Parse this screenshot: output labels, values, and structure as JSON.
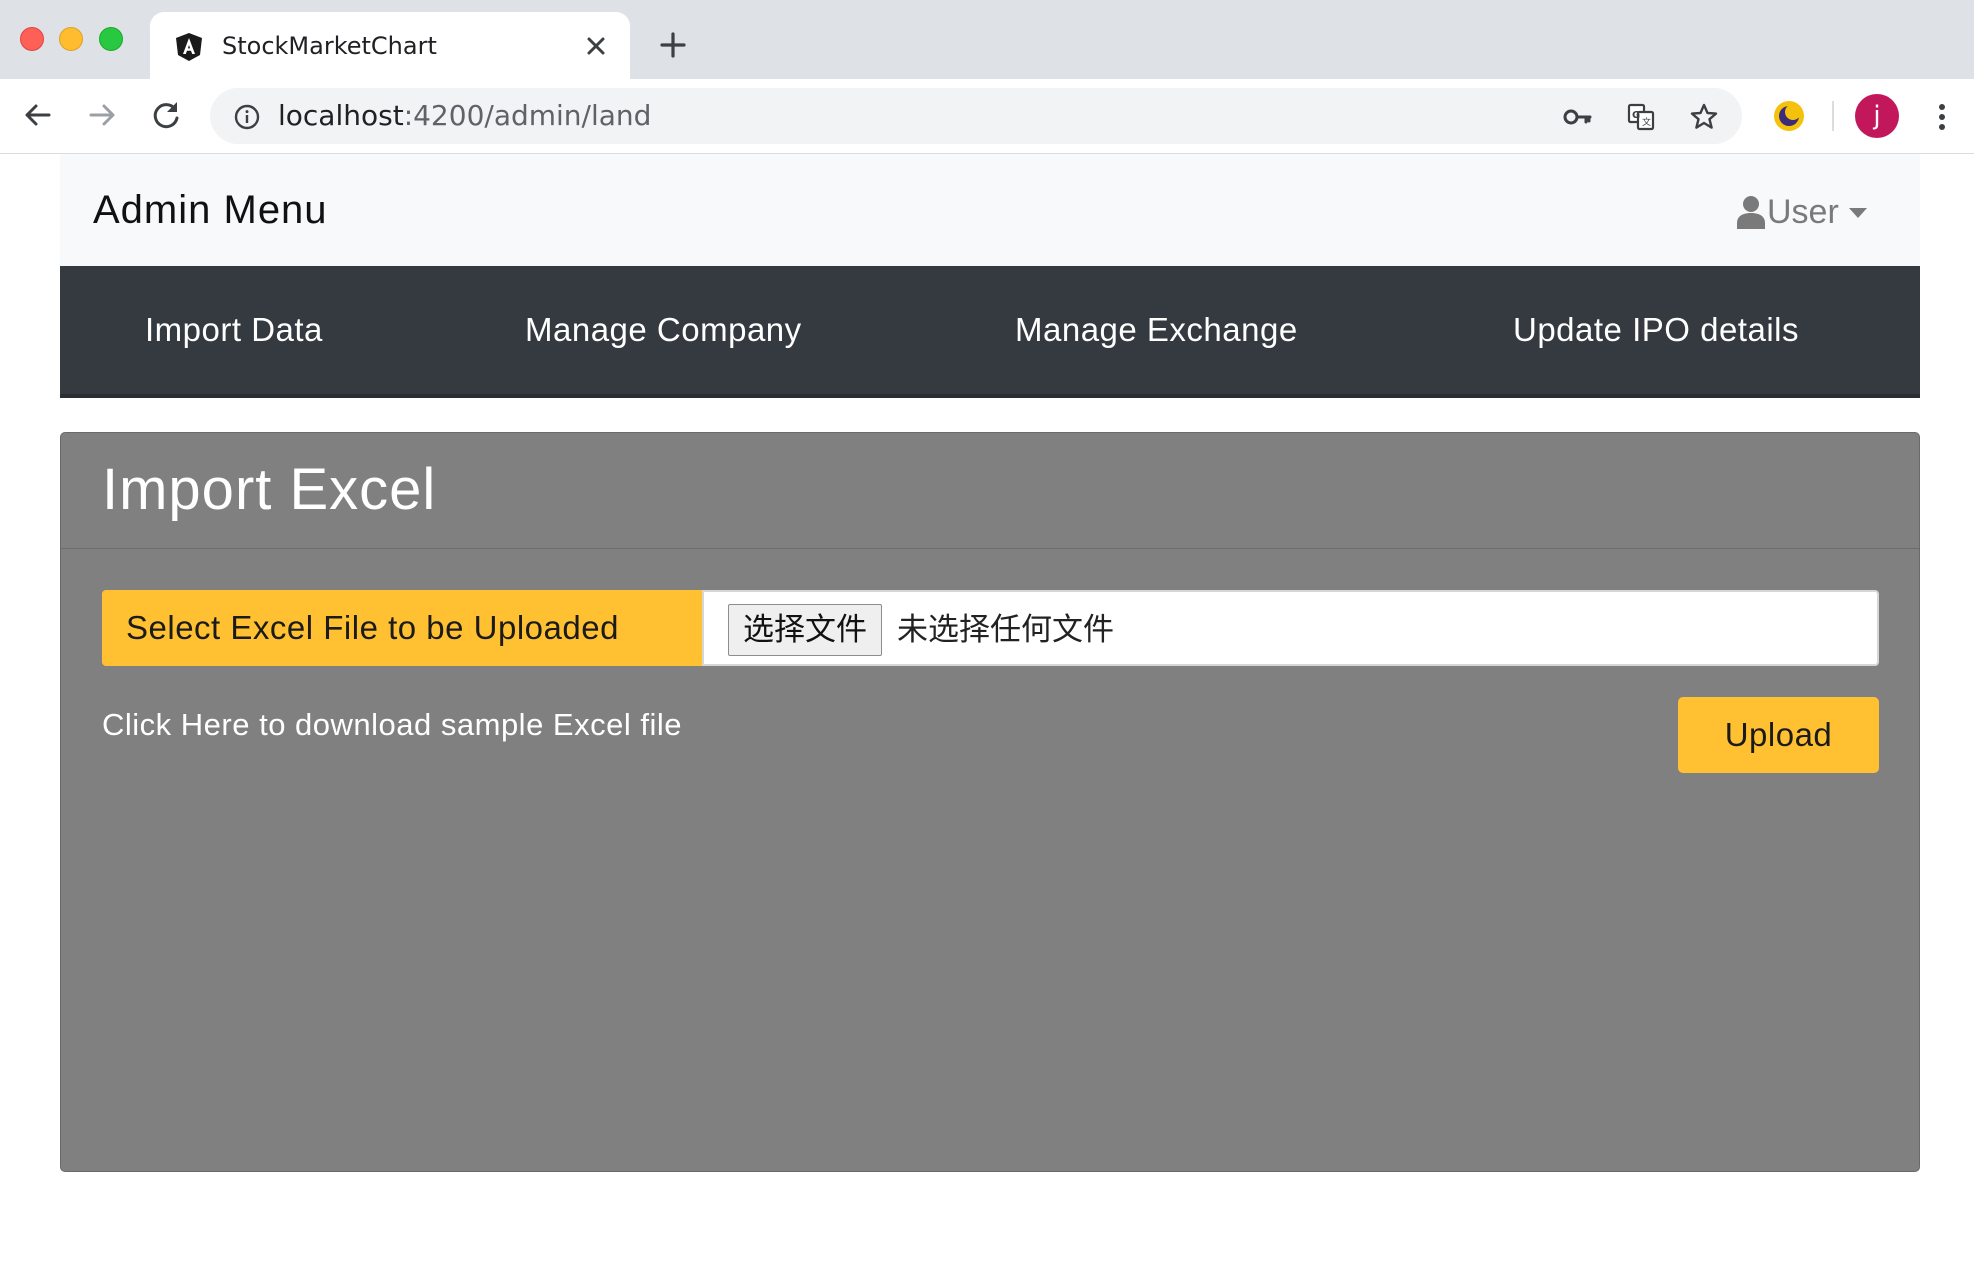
{
  "browser": {
    "tab_title": "StockMarketChart",
    "url_host": "localhost",
    "url_path": ":4200/admin/land",
    "avatar_letter": "j",
    "icons": [
      "angular-favicon",
      "close-icon",
      "plus-icon",
      "back-arrow-icon",
      "forward-arrow-icon",
      "reload-icon",
      "info-icon",
      "key-icon",
      "translate-icon",
      "star-icon",
      "extension-moon-icon",
      "kebab-menu-icon"
    ]
  },
  "header": {
    "brand": "Admin Menu",
    "user_label": "User"
  },
  "nav": {
    "items": [
      {
        "label": "Import Data"
      },
      {
        "label": "Manage Company"
      },
      {
        "label": "Manage Exchange"
      },
      {
        "label": "Update IPO details"
      }
    ]
  },
  "card": {
    "title": "Import Excel",
    "file_label": "Select Excel File to be Uploaded",
    "choose_button": "选择文件",
    "file_status": "未选择任何文件",
    "sample_link": "Click Here to download sample Excel file",
    "upload_button": "Upload"
  },
  "colors": {
    "navbar_bg": "#343a40",
    "card_bg": "#808080",
    "accent_yellow": "#ffc132",
    "admin_bar_bg": "#f8f9fa",
    "avatar_bg": "#c2185b"
  }
}
